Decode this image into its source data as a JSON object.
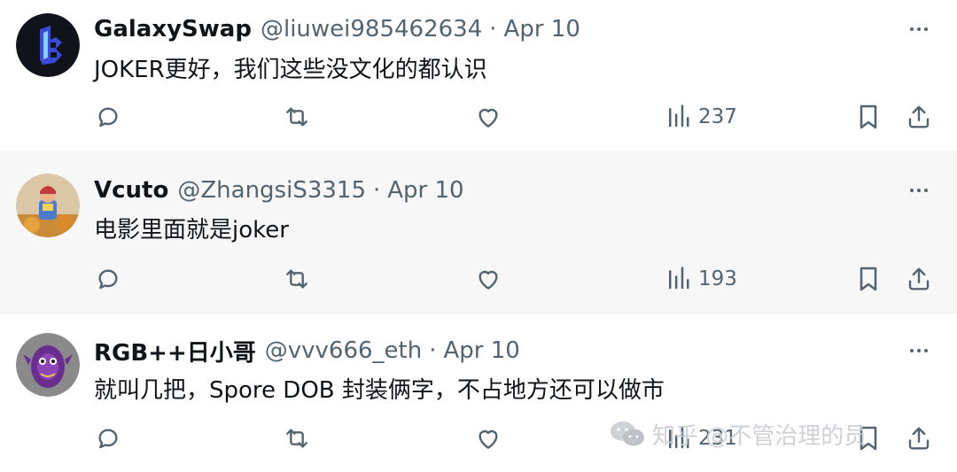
{
  "posts": [
    {
      "display_name": "GalaxySwap",
      "handle": "@liuwei985462634",
      "separator": "·",
      "date": "Apr 10",
      "text": "JOKER更好，我们这些没文化的都认识",
      "views": "237"
    },
    {
      "display_name": "Vcuto",
      "handle": "@ZhangsiS3315",
      "separator": "·",
      "date": "Apr 10",
      "text": "电影里面就是joker",
      "views": "193"
    },
    {
      "display_name": "RGB++日小哥",
      "handle": "@vvv666_eth",
      "separator": "·",
      "date": "Apr 10",
      "text": "就叫几把，Spore DOB 封装俩字，不占地方还可以做市",
      "views": "231"
    }
  ],
  "icons": {
    "reply": "reply-icon",
    "retweet": "retweet-icon",
    "like": "heart-icon",
    "views": "views-bar-chart-icon",
    "bookmark": "bookmark-icon",
    "share": "share-upload-icon",
    "more": "more-dots-icon"
  },
  "colors": {
    "text": "#0f1419",
    "secondary": "#536471",
    "highlight_background": "#f7f7f7",
    "watermark": "#c9cdd1"
  },
  "watermark": {
    "text": "知乎 @不管治理的员"
  }
}
